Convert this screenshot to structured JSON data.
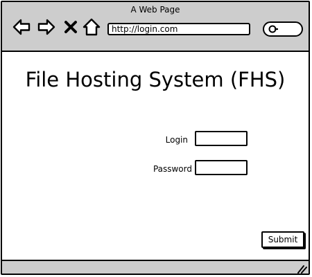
{
  "window": {
    "title": "A Web Page"
  },
  "toolbar": {
    "back_icon": "arrow-left-icon",
    "forward_icon": "arrow-right-icon",
    "stop_icon": "close-icon",
    "home_icon": "home-icon",
    "url": "http://login.com",
    "search_icon": "search-icon"
  },
  "page": {
    "title": "File Hosting System (FHS)"
  },
  "form": {
    "login_label": "Login",
    "login_value": "",
    "password_label": "Password",
    "password_value": "",
    "submit_label": "Submit"
  },
  "statusbar": {
    "grip_icon": "resize-grip-icon"
  },
  "colors": {
    "chrome": "#cdcdcd",
    "stroke": "#000000",
    "background": "#ffffff"
  }
}
